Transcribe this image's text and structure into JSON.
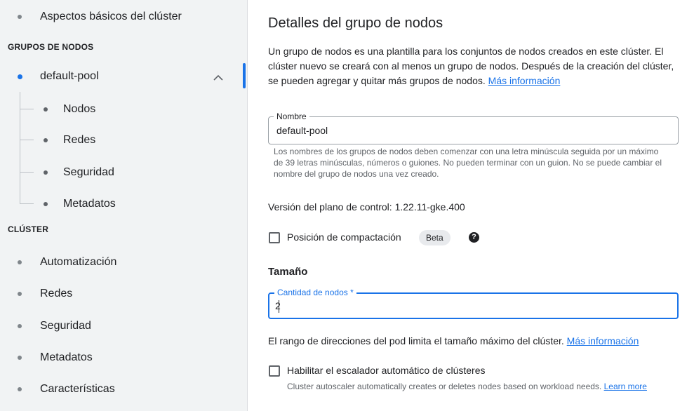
{
  "sidebar": {
    "basics": "Aspectos básicos del clúster",
    "node_groups_header": "GRUPOS DE NODOS",
    "default_pool": "default-pool",
    "pool_children": [
      "Nodos",
      "Redes",
      "Seguridad",
      "Metadatos"
    ],
    "cluster_header": "CLÚSTER",
    "cluster_items": [
      "Automatización",
      "Redes",
      "Seguridad",
      "Metadatos",
      "Características"
    ]
  },
  "main": {
    "title": "Detalles del grupo de nodos",
    "description": "Un grupo de nodos es una plantilla para los conjuntos de nodos creados en este clúster. El clúster nuevo se creará con al menos un grupo de nodos. Después de la creación del clúster, se pueden agregar y quitar más grupos de nodos.",
    "more_info": "Más información",
    "name_field": {
      "label": "Nombre",
      "value": "default-pool",
      "hint": "Los nombres de los grupos de nodos deben comenzar con una letra minúscula seguida por un máximo de 39 letras minúsculas, números o guiones. No pueden terminar con un guion. No se puede cambiar el nombre del grupo de nodos una vez creado."
    },
    "control_plane_version": "Versión del plano de control: 1.22.11-gke.400",
    "compact_placement": {
      "label": "Posición de compactación",
      "badge": "Beta",
      "help": "?",
      "checked": false
    },
    "size_title": "Tamaño",
    "node_count_field": {
      "label": "Cantidad de nodos *",
      "value": "2"
    },
    "pod_range_text": "El rango de direcciones del pod limita el tamaño máximo del clúster.",
    "pod_range_link": "Más información",
    "autoscaler": {
      "label": "Habilitar el escalador automático de clústeres",
      "hint": "Cluster autoscaler automatically creates or deletes nodes based on workload needs.",
      "link": "Learn more",
      "checked": false
    }
  },
  "colors": {
    "accent": "#1a73e8",
    "sidebar_bg": "#f1f3f4",
    "text": "#202124",
    "secondary_text": "#5f6368"
  }
}
